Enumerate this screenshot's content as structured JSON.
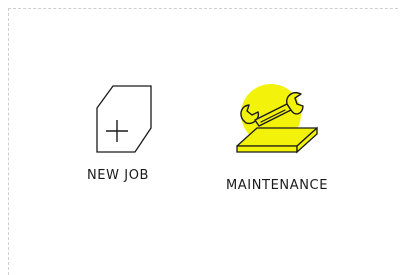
{
  "tiles": [
    {
      "label": "NEW JOB",
      "icon": "new-job-icon"
    },
    {
      "label": "MAINTENANCE",
      "icon": "maintenance-wrench-icon"
    }
  ],
  "colors": {
    "accent": "#f2f20a",
    "stroke": "#1a1a1a",
    "border": "#cfcfcf",
    "background": "#ffffff"
  }
}
